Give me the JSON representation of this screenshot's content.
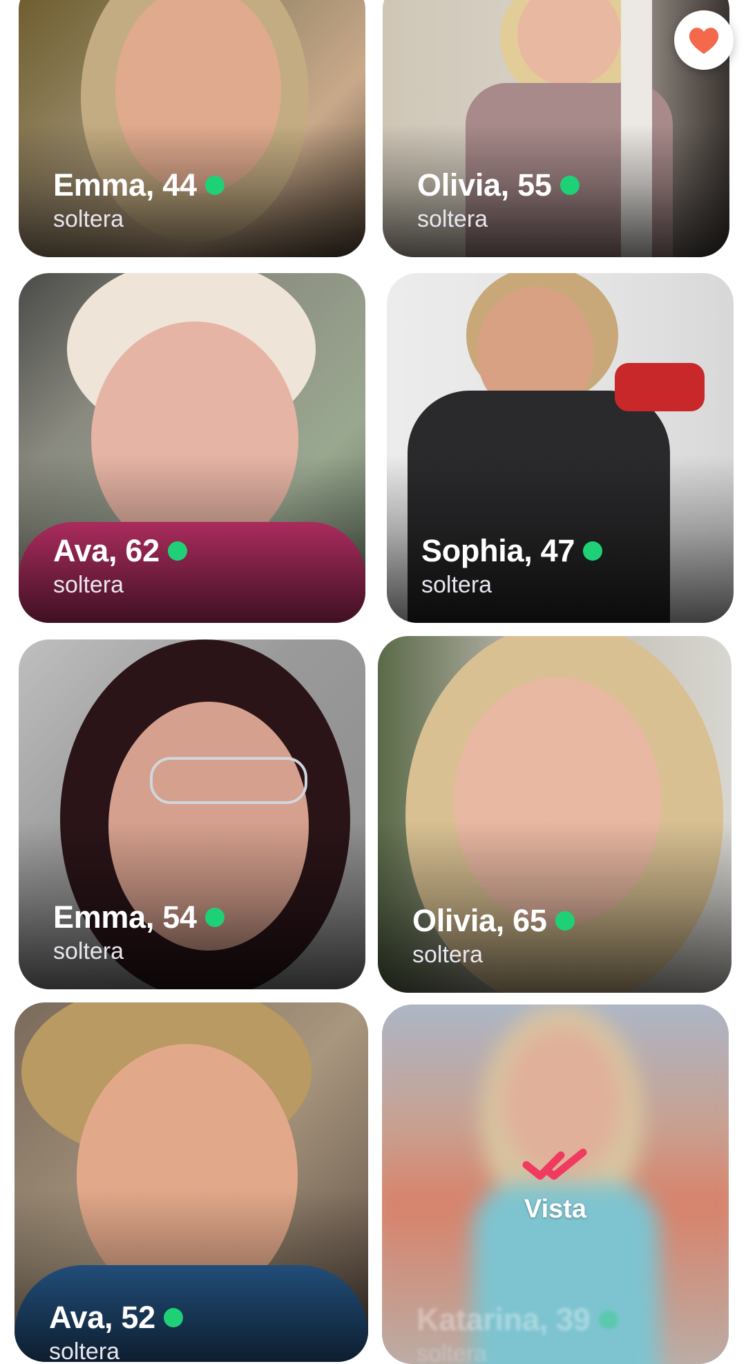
{
  "cards": [
    {
      "name_age": "Emma, 44",
      "status": "soltera",
      "online": true
    },
    {
      "name_age": "Olivia, 55",
      "status": "soltera",
      "online": true
    },
    {
      "name_age": "Ava, 62",
      "status": "soltera",
      "online": true
    },
    {
      "name_age": "Sophia, 47",
      "status": "soltera",
      "online": true
    },
    {
      "name_age": "Emma, 54",
      "status": "soltera",
      "online": true
    },
    {
      "name_age": "Olivia, 65",
      "status": "soltera",
      "online": true
    },
    {
      "name_age": "Ava, 52",
      "status": "soltera",
      "online": true
    },
    {
      "name_age": "Katarina, 39",
      "status": "soltera",
      "online": true,
      "seen": true,
      "seen_label": "Vista"
    }
  ],
  "icons": {
    "online": "online-dot-icon",
    "like": "heart-chat-bubble-icon",
    "seen": "double-check-icon"
  },
  "colors": {
    "online": "#1fd176",
    "like": "#f4694b",
    "seen": "#f03a5f"
  }
}
